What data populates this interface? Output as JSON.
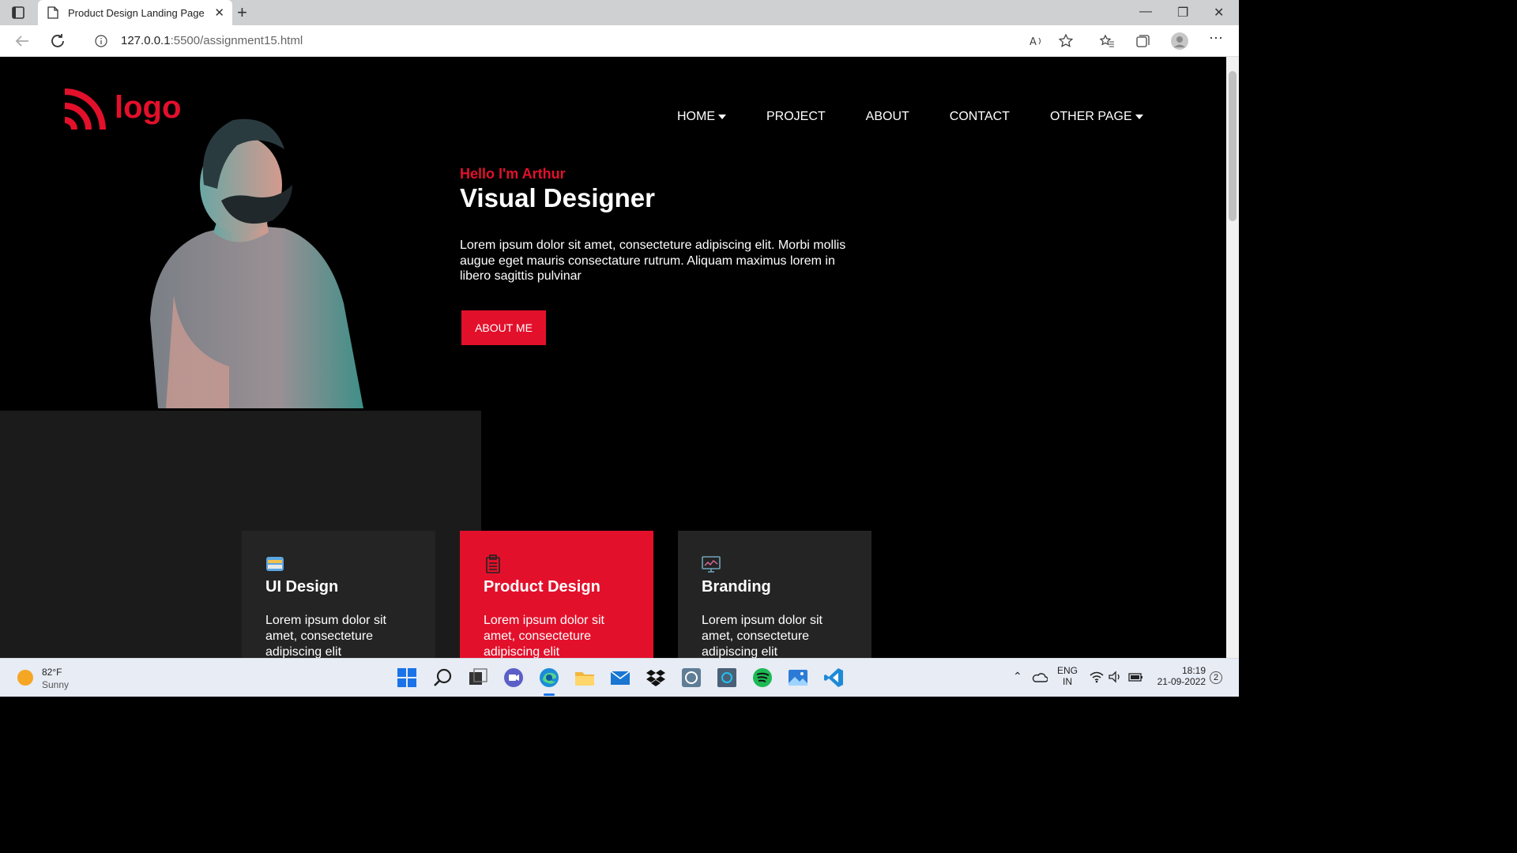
{
  "browser": {
    "tab_title": "Product Design Landing Page",
    "url_host": "127.0.0.1",
    "url_path": ":5500/assignment15.html"
  },
  "site": {
    "logo_text": "logo",
    "menu": [
      "HOME",
      "PROJECT",
      "ABOUT",
      "CONTACT",
      "OTHER PAGE"
    ],
    "hello": "Hello I'm Arthur",
    "headline": "Visual Designer",
    "intro": "Lorem ipsum dolor sit amet, consecteture adipiscing elit. Morbi mollis augue eget mauris consectature rutrum. Aliquam maximus lorem in libero sagittis pulvinar",
    "cta": "ABOUT ME",
    "cards": [
      {
        "title": "UI Design",
        "text": "Lorem ipsum dolor sit amet, consecteture adipiscing elit",
        "icon": "ui-design-icon"
      },
      {
        "title": "Product Design",
        "text": "Lorem ipsum dolor sit amet, consecteture adipiscing elit",
        "icon": "clipboard-icon"
      },
      {
        "title": "Branding",
        "text": "Lorem ipsum dolor sit amet, consecteture adipiscing elit",
        "icon": "monitor-chart-icon"
      }
    ],
    "accent_color": "#e3102b"
  },
  "taskbar": {
    "temp": "82°F",
    "condition": "Sunny",
    "lang_top": "ENG",
    "lang_bottom": "IN",
    "time": "18:19",
    "date": "21-09-2022",
    "notif_count": "2"
  }
}
